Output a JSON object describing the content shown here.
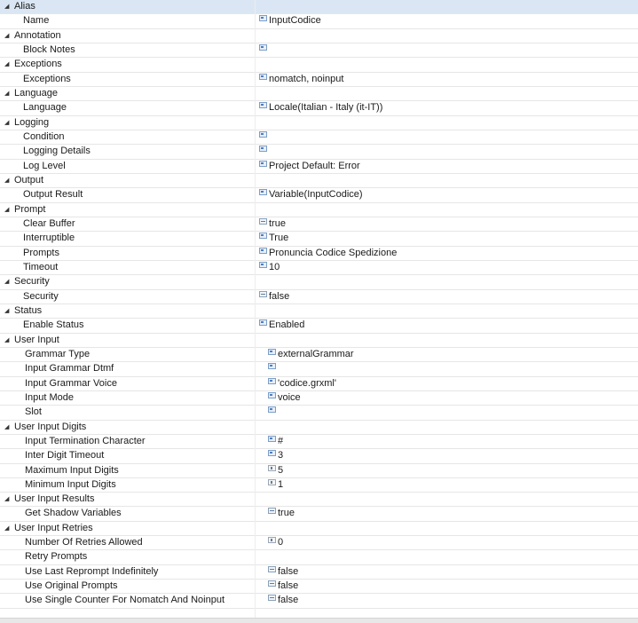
{
  "properties": [
    {
      "label": "Alias",
      "category": true,
      "selected": true,
      "children": [
        {
          "label": "Name",
          "value": "InputCodice",
          "icon": "text"
        }
      ]
    },
    {
      "label": "Annotation",
      "category": true,
      "children": [
        {
          "label": "Block Notes",
          "value": "",
          "icon": "text"
        }
      ]
    },
    {
      "label": "Exceptions",
      "category": true,
      "children": [
        {
          "label": "Exceptions",
          "value": "nomatch, noinput",
          "icon": "text"
        }
      ]
    },
    {
      "label": "Language",
      "category": true,
      "children": [
        {
          "label": "Language",
          "value": "Locale(Italian - Italy (it-IT))",
          "icon": "text"
        }
      ]
    },
    {
      "label": "Logging",
      "category": true,
      "children": [
        {
          "label": "Condition",
          "value": "",
          "icon": "text"
        },
        {
          "label": "Logging Details",
          "value": "",
          "icon": "text"
        },
        {
          "label": "Log Level",
          "value": "Project Default: Error",
          "icon": "text"
        }
      ]
    },
    {
      "label": "Output",
      "category": true,
      "children": [
        {
          "label": "Output Result",
          "value": "Variable(InputCodice)",
          "icon": "text"
        }
      ]
    },
    {
      "label": "Prompt",
      "category": true,
      "children": [
        {
          "label": "Clear Buffer",
          "value": "true",
          "icon": "bool"
        },
        {
          "label": "Interruptible",
          "value": "True",
          "icon": "text"
        },
        {
          "label": "Prompts",
          "value": "Pronuncia Codice Spedizione",
          "icon": "text"
        },
        {
          "label": "Timeout",
          "value": "10",
          "icon": "text"
        }
      ]
    },
    {
      "label": "Security",
      "category": true,
      "children": [
        {
          "label": "Security",
          "value": "false",
          "icon": "bool"
        }
      ]
    },
    {
      "label": "Status",
      "category": true,
      "children": [
        {
          "label": "Enable Status",
          "value": "Enabled",
          "icon": "text"
        }
      ]
    },
    {
      "label": "User Input",
      "category": true,
      "children": [
        {
          "label": "Grammar Type",
          "value": "externalGrammar",
          "icon": "text"
        },
        {
          "label": "Input Grammar Dtmf",
          "value": "",
          "icon": "text"
        },
        {
          "label": "Input Grammar Voice",
          "value": "'codice.grxml'",
          "icon": "text"
        },
        {
          "label": "Input Mode",
          "value": "voice",
          "icon": "text"
        },
        {
          "label": "Slot",
          "value": "",
          "icon": "text"
        }
      ]
    },
    {
      "label": "User Input Digits",
      "category": true,
      "children": [
        {
          "label": "Input Termination Character",
          "value": "#",
          "icon": "text"
        },
        {
          "label": "Inter Digit Timeout",
          "value": "3",
          "icon": "text"
        },
        {
          "label": "Maximum Input Digits",
          "value": "5",
          "icon": "num"
        },
        {
          "label": "Minimum Input Digits",
          "value": "1",
          "icon": "num"
        }
      ]
    },
    {
      "label": "User Input Results",
      "category": true,
      "children": [
        {
          "label": "Get Shadow Variables",
          "value": "true",
          "icon": "bool"
        }
      ]
    },
    {
      "label": "User Input Retries",
      "category": true,
      "children": [
        {
          "label": "Number Of Retries Allowed",
          "value": "0",
          "icon": "num"
        },
        {
          "label": "Retry Prompts",
          "value": "",
          "icon": "none"
        },
        {
          "label": "Use Last Reprompt Indefinitely",
          "value": "false",
          "icon": "bool"
        },
        {
          "label": "Use Original Prompts",
          "value": "false",
          "icon": "bool"
        },
        {
          "label": "Use Single Counter For Nomatch And Noinput",
          "value": "false",
          "icon": "bool"
        }
      ]
    }
  ]
}
